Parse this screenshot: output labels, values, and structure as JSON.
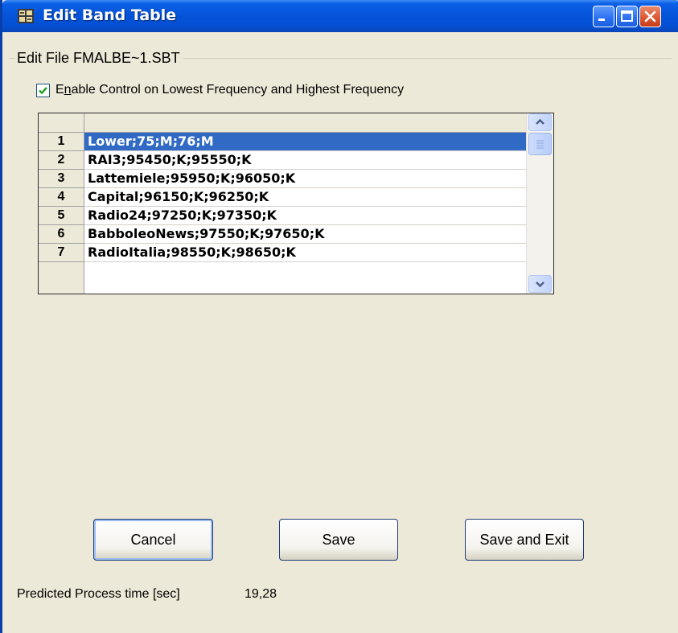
{
  "window": {
    "title": "Edit Band Table"
  },
  "group": {
    "label": "Edit File FMALBE~1.SBT"
  },
  "checkbox": {
    "checked": true,
    "label_prefix": "E",
    "label_mnemonic": "n",
    "label_rest": "able Control on Lowest Frequency and Highest Frequency"
  },
  "grid": {
    "rows": [
      {
        "num": "1",
        "value": "Lower;75;M;76;M",
        "selected": true
      },
      {
        "num": "2",
        "value": "RAI3;95450;K;95550;K",
        "selected": false
      },
      {
        "num": "3",
        "value": "Lattemiele;95950;K;96050;K",
        "selected": false
      },
      {
        "num": "4",
        "value": "Capital;96150;K;96250;K",
        "selected": false
      },
      {
        "num": "5",
        "value": "Radio24;97250;K;97350;K",
        "selected": false
      },
      {
        "num": "6",
        "value": "BabboleoNews;97550;K;97650;K",
        "selected": false
      },
      {
        "num": "7",
        "value": "RadioItalia;98550;K;98650;K",
        "selected": false
      }
    ]
  },
  "buttons": {
    "cancel": "Cancel",
    "save": "Save",
    "save_and_exit": "Save and Exit"
  },
  "status": {
    "label": "Predicted Process time [sec]",
    "value": "19,28"
  },
  "colors": {
    "titlebar": "#0453d8",
    "selection": "#316ac5",
    "window_bg": "#ece9d8"
  }
}
